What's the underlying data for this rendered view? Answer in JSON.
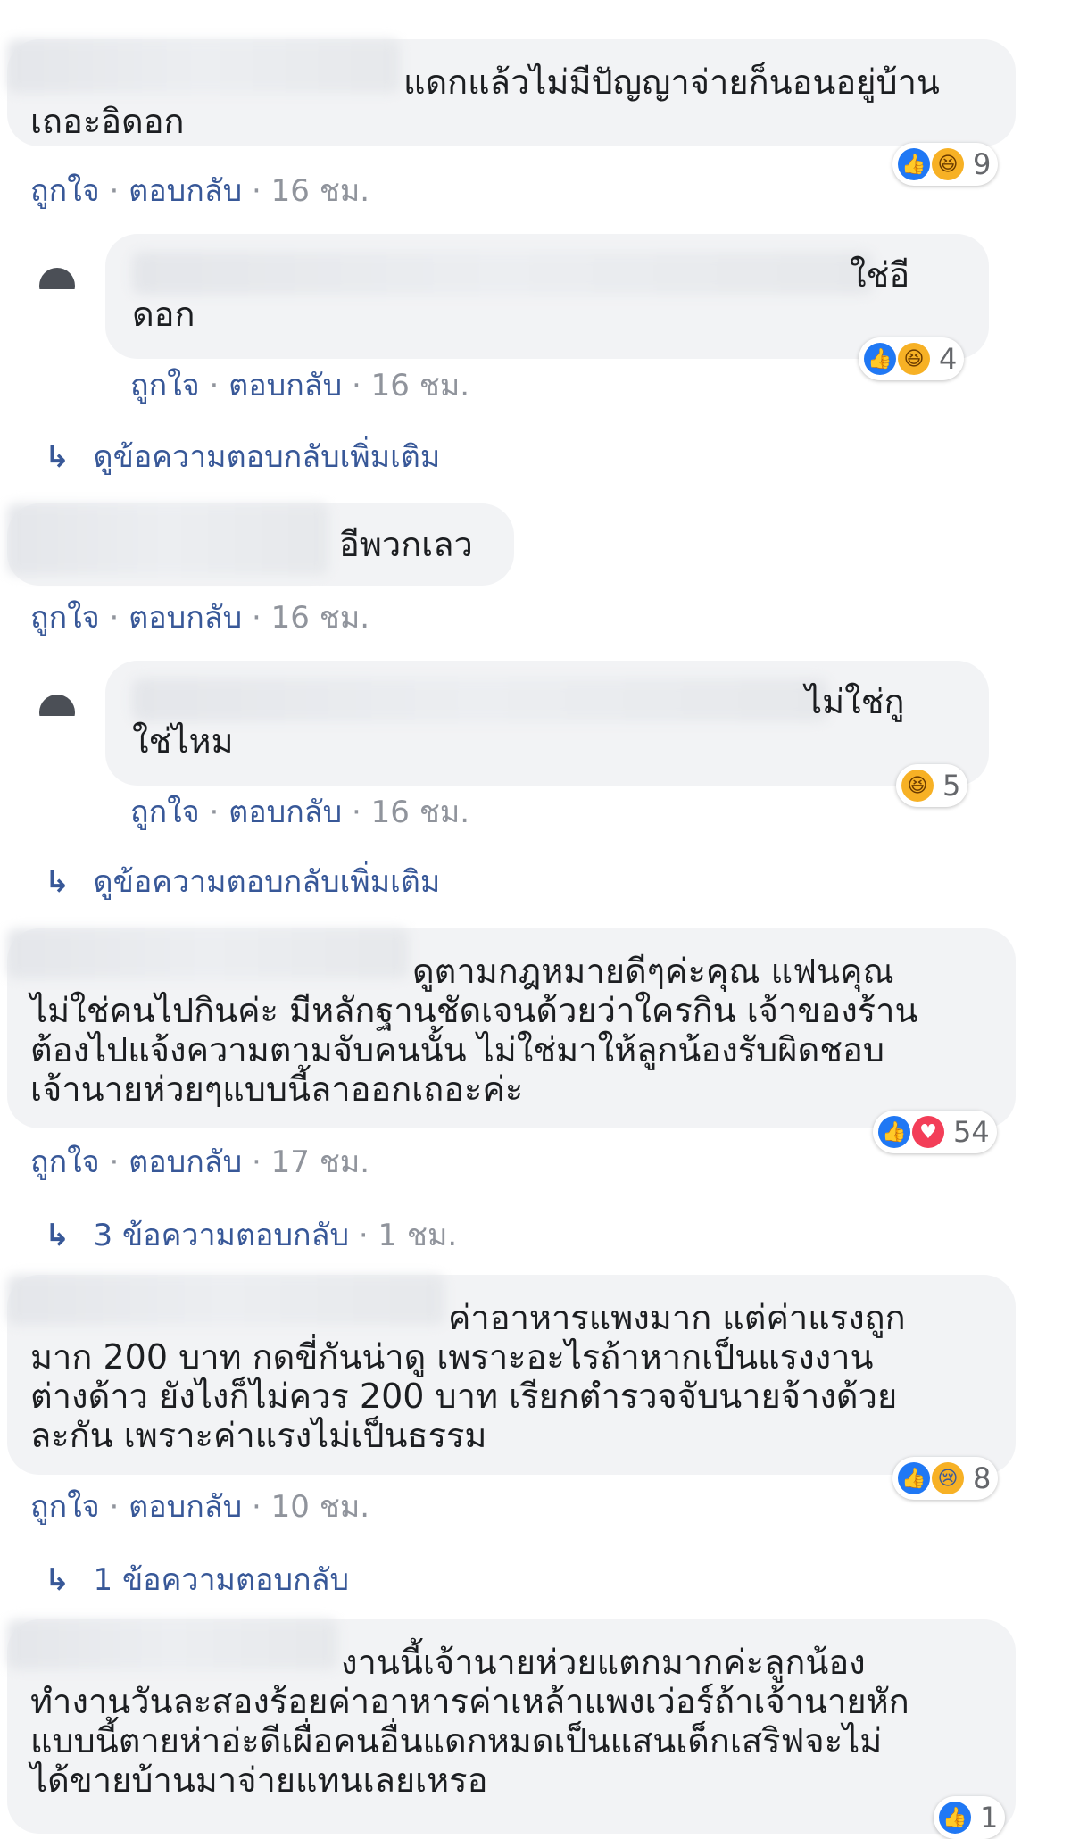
{
  "comments": [
    {
      "text": "แดกแล้วไม่มีปัญญาจ่ายก็นอนอยู่บ้าน\nเถอะอิดอก",
      "like": "ถูกใจ",
      "reply": "ตอบกลับ",
      "time": "16 ชม.",
      "reactions": [
        "like",
        "haha"
      ],
      "count": "9"
    },
    {
      "text": "ใช่อี\nดอก",
      "like": "ถูกใจ",
      "reply": "ตอบกลับ",
      "time": "16 ชม.",
      "reactions": [
        "like",
        "haha"
      ],
      "count": "4",
      "more": "ดูข้อความตอบกลับเพิ่มเติม"
    },
    {
      "text": "อีพวกเลว",
      "like": "ถูกใจ",
      "reply": "ตอบกลับ",
      "time": "16 ชม."
    },
    {
      "text": "ไม่ใช่กู\nใช่ไหม",
      "like": "ถูกใจ",
      "reply": "ตอบกลับ",
      "time": "16 ชม.",
      "reactions": [
        "haha"
      ],
      "count": "5",
      "more": "ดูข้อความตอบกลับเพิ่มเติม"
    },
    {
      "text": "ดูตามกฎหมายดีๆค่ะคุณ แฟนคุณ\nไม่ใช่คนไปกินค่ะ มีหลักฐานชัดเจนด้วยว่าใครกิน เจ้าของร้าน\nต้องไปแจ้งความตามจับคนนั้น ไม่ใช่มาให้ลูกน้องรับผิดชอบ\nเจ้านายห่วยๆแบบนี้ลาออกเถอะค่ะ",
      "like": "ถูกใจ",
      "reply": "ตอบกลับ",
      "time": "17 ชม.",
      "reactions": [
        "like",
        "love"
      ],
      "count": "54",
      "more": "3 ข้อความตอบกลับ",
      "more_time": "1 ชม."
    },
    {
      "text": "ค่าอาหารแพงมาก แต่ค่าแรงถูก\nมาก 200 บาท กดขี่กันน่าดู เพราะอะไรถ้าหากเป็นแรงงาน\nต่างด้าว ยังไงก็ไม่ควร 200 บาท เรียกตำรวจจับนายจ้างด้วย\nละกัน เพราะค่าแรงไม่เป็นธรรม",
      "like": "ถูกใจ",
      "reply": "ตอบกลับ",
      "time": "10 ชม.",
      "reactions": [
        "like",
        "sad"
      ],
      "count": "8",
      "more": "1 ข้อความตอบกลับ"
    },
    {
      "text": "งานนี้เจ้านายห่วยแตกมากค่ะลูกน้อง\nทำงานวันละสองร้อยค่าอาหารค่าเหล้าแพงเว่อร์ถ้าเจ้านายหัก\nแบบนี้ตายห่าอ่ะดีเผื่อคนอื่นแดกหมดเป็นแสนเด็กเสริฟจะไม่\nได้ขายบ้านมาจ่ายแทนเลยเหรอ",
      "count": "1"
    }
  ],
  "icons": {
    "like": "thumbs-up-icon",
    "haha": "haha-icon",
    "love": "love-icon",
    "sad": "sad-icon",
    "arrow": "reply-arrow-icon"
  }
}
